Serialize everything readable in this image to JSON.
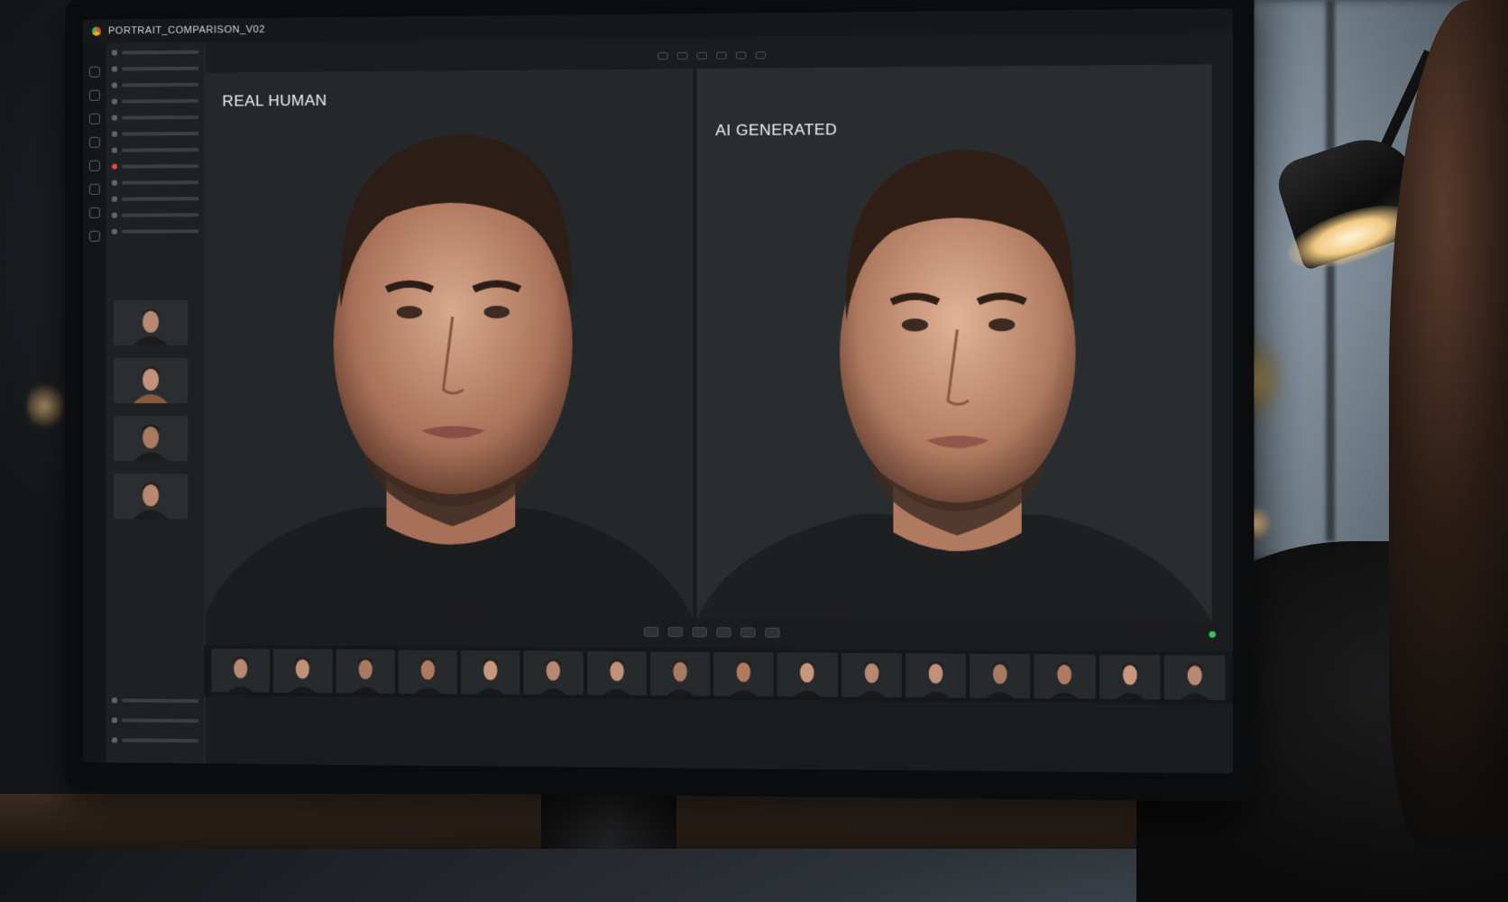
{
  "window": {
    "title": "PORTRAIT_COMPARISON_V02"
  },
  "panels": {
    "left": {
      "label": "REAL HUMAN"
    },
    "right": {
      "label": "AI GENERATED"
    }
  },
  "colors": {
    "accent_red": "#e0493f",
    "status_green": "#33c759",
    "lamp_light": "#f2c982"
  },
  "icons": {
    "app": "app-logo-icon",
    "status": "status-dot-icon"
  }
}
